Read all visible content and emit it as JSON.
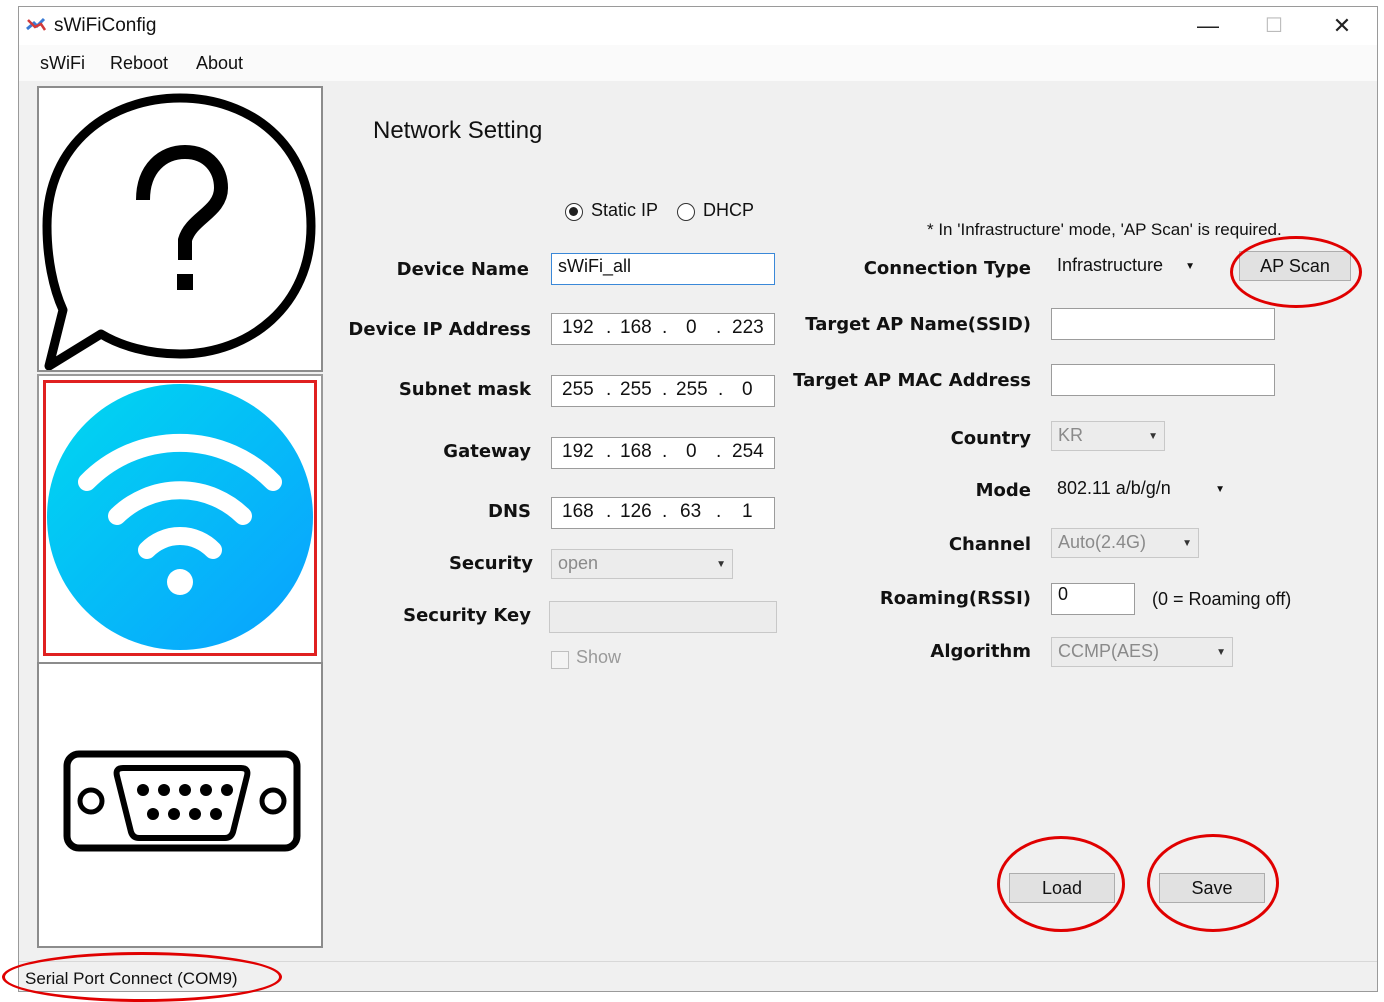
{
  "window": {
    "title": "sWiFiConfig",
    "minimize": "—",
    "maximize": "☐",
    "close": "✕"
  },
  "menu": [
    "sWiFi",
    "Reboot",
    "About"
  ],
  "page_title": "Network Setting",
  "ip_mode": {
    "static_label": "Static IP",
    "dhcp_label": "DHCP",
    "selected": "Static IP"
  },
  "note": "* In 'Infrastructure' mode, 'AP Scan' is required.",
  "left": {
    "device_name": {
      "label": "Device Name",
      "value": "sWiFi_all"
    },
    "device_ip": {
      "label": "Device IP Address",
      "octets": [
        "192",
        "168",
        "0",
        "223"
      ]
    },
    "subnet": {
      "label": "Subnet mask",
      "octets": [
        "255",
        "255",
        "255",
        "0"
      ]
    },
    "gateway": {
      "label": "Gateway",
      "octets": [
        "192",
        "168",
        "0",
        "254"
      ]
    },
    "dns": {
      "label": "DNS",
      "octets": [
        "168",
        "126",
        "63",
        "1"
      ]
    },
    "security": {
      "label": "Security",
      "value": "open"
    },
    "security_key": {
      "label": "Security Key",
      "value": ""
    },
    "show": {
      "label": "Show",
      "checked": false
    }
  },
  "right": {
    "connection_type": {
      "label": "Connection Type",
      "value": "Infrastructure"
    },
    "ap_scan": "AP Scan",
    "target_ssid": {
      "label": "Target AP Name(SSID)",
      "value": ""
    },
    "target_mac": {
      "label": "Target AP MAC Address",
      "value": ""
    },
    "country": {
      "label": "Country",
      "value": "KR"
    },
    "mode": {
      "label": "Mode",
      "value": "802.11 a/b/g/n"
    },
    "channel": {
      "label": "Channel",
      "value": "Auto(2.4G)"
    },
    "roaming": {
      "label": "Roaming(RSSI)",
      "value": "0",
      "hint": "(0 = Roaming off)"
    },
    "algorithm": {
      "label": "Algorithm",
      "value": "CCMP(AES)"
    }
  },
  "buttons": {
    "load": "Load",
    "save": "Save"
  },
  "status": "Serial Port Connect (COM9)",
  "colors": {
    "highlight": "#e00000",
    "wifi_start": "#00d4f0",
    "wifi_end": "#0aa6ff",
    "selected_panel": "#e02020"
  },
  "icons": {
    "help": "help-speech-bubble-icon",
    "wifi": "wifi-icon",
    "serial": "serial-port-icon"
  }
}
